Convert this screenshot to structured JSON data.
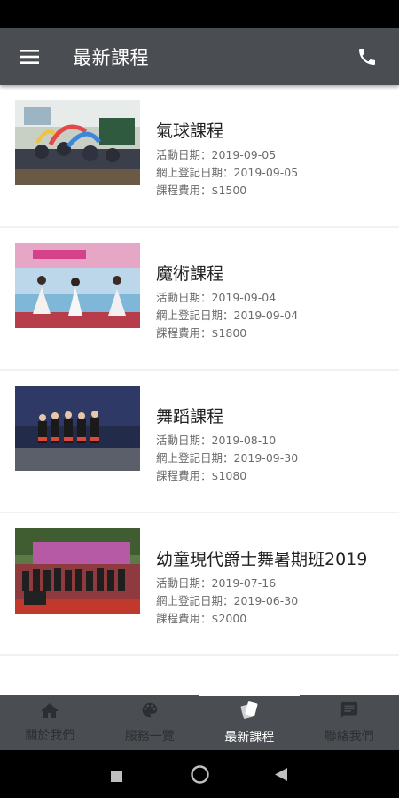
{
  "app_bar": {
    "title": "最新課程",
    "menu_icon": "hamburger-menu-icon",
    "phone_icon": "phone-icon"
  },
  "courses": [
    {
      "title": "氣球課程",
      "activity_date": "活動日期：2019-09-05",
      "register_date": "網上登記日期：2019-09-05",
      "fee": "課程費用：$1500"
    },
    {
      "title": "魔術課程",
      "activity_date": "活動日期：2019-09-04",
      "register_date": "網上登記日期：2019-09-04",
      "fee": "課程費用：$1800"
    },
    {
      "title": "舞蹈課程",
      "activity_date": "活動日期：2019-08-10",
      "register_date": "網上登記日期：2019-09-30",
      "fee": "課程費用：$1080"
    },
    {
      "title": "幼童現代爵士舞暑期班2019",
      "activity_date": "活動日期：2019-07-16",
      "register_date": "網上登記日期：2019-06-30",
      "fee": "課程費用：$2000"
    }
  ],
  "bottom_nav": [
    {
      "label": "關於我們",
      "icon": "home-icon"
    },
    {
      "label": "服務一覽",
      "icon": "palette-icon"
    },
    {
      "label": "最新課程",
      "icon": "cards-icon"
    },
    {
      "label": "聯絡我們",
      "icon": "chat-icon"
    }
  ],
  "colors": {
    "app_bar": "#4a4e52",
    "nav_active": "#ffffff",
    "nav_inactive": "#2c2f32"
  }
}
